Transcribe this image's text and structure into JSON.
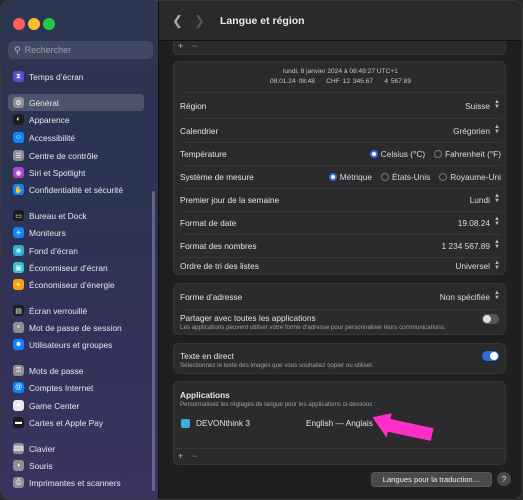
{
  "sidebar": {
    "search_placeholder": "Rechercher",
    "items": [
      {
        "label": "Temps d’écran",
        "icon": "hourglass-icon",
        "color": "#5a4fcf"
      },
      {
        "label": "Général",
        "icon": "gear-icon",
        "color": "#8e8e93"
      },
      {
        "label": "Apparence",
        "icon": "appearance-icon",
        "color": "#1c1c1e"
      },
      {
        "label": "Accessibilité",
        "icon": "accessibility-icon",
        "color": "#0a84ff"
      },
      {
        "label": "Centre de contrôle",
        "icon": "control-center-icon",
        "color": "#8e8e93"
      },
      {
        "label": "Siri et Spotlight",
        "icon": "siri-icon",
        "color": "#b040d0"
      },
      {
        "label": "Confidentialité et sécurité",
        "icon": "hand-icon",
        "color": "#0a84ff"
      },
      {
        "label": "Bureau et Dock",
        "icon": "dock-icon",
        "color": "#1c1c1e"
      },
      {
        "label": "Moniteurs",
        "icon": "display-icon",
        "color": "#0a84ff"
      },
      {
        "label": "Fond d’écran",
        "icon": "wallpaper-icon",
        "color": "#30b0d0"
      },
      {
        "label": "Économiseur d’écran",
        "icon": "screensaver-icon",
        "color": "#30c0d0"
      },
      {
        "label": "Économiseur d’énergie",
        "icon": "energy-icon",
        "color": "#ff9f0a"
      },
      {
        "label": "Écran verrouillé",
        "icon": "lock-screen-icon",
        "color": "#1c1c1e"
      },
      {
        "label": "Mot de passe de session",
        "icon": "password-icon",
        "color": "#8e8e93"
      },
      {
        "label": "Utilisateurs et groupes",
        "icon": "users-icon",
        "color": "#0a84ff"
      },
      {
        "label": "Mots de passe",
        "icon": "key-icon",
        "color": "#8e8e93"
      },
      {
        "label": "Comptes Internet",
        "icon": "at-icon",
        "color": "#0a84ff"
      },
      {
        "label": "Game Center",
        "icon": "game-center-icon",
        "color": "#e8e8e8"
      },
      {
        "label": "Cartes et Apple Pay",
        "icon": "wallet-icon",
        "color": "#1c1c1e"
      },
      {
        "label": "Clavier",
        "icon": "keyboard-icon",
        "color": "#8e8e93"
      },
      {
        "label": "Souris",
        "icon": "mouse-icon",
        "color": "#8e8e93"
      },
      {
        "label": "Imprimantes et scanners",
        "icon": "printer-icon",
        "color": "#8e8e93"
      }
    ],
    "selected": "Général"
  },
  "title": "Langue et région",
  "preview": {
    "line1": "lundi, 8 janvier 2024 à 08:48:27 UTC+1",
    "line2a": "08.01.24 08:48",
    "line2b": "CHF 12 345.67",
    "line2c": "4 567.89"
  },
  "settings": {
    "region": {
      "label": "Région",
      "value": "Suisse"
    },
    "calendar": {
      "label": "Calendrier",
      "value": "Grégorien"
    },
    "temperature": {
      "label": "Température",
      "opt1": "Celsius (°C)",
      "opt2": "Fahrenheit (°F)",
      "selected": "Celsius (°C)"
    },
    "measure": {
      "label": "Système de mesure",
      "opt1": "Métrique",
      "opt2": "États-Unis",
      "opt3": "Royaume-Uni",
      "selected": "Métrique"
    },
    "first_day": {
      "label": "Premier jour de la semaine",
      "value": "Lundi"
    },
    "date_format": {
      "label": "Format de date",
      "value": "19.08.24"
    },
    "number_format": {
      "label": "Format des nombres",
      "value": "1 234 567.89"
    },
    "sort_order": {
      "label": "Ordre de tri des listes",
      "value": "Universel"
    }
  },
  "address": {
    "label": "Forme d’adresse",
    "value": "Non spécifiée",
    "share_label": "Partager avec toutes les applications",
    "share_desc": "Les applications peuvent utiliser votre forme d’adresse pour personnaliser leurs communications.",
    "share_on": false
  },
  "live_text": {
    "label": "Texte en direct",
    "desc": "Sélectionnez le texte des images que vous souhaitez copier ou utiliser.",
    "on": true
  },
  "applications": {
    "title": "Applications",
    "desc": "Personnalisez les réglages de langue pour les applications ci-dessous :",
    "items": [
      {
        "name": "DEVONthink 3",
        "language": "English — Anglais"
      }
    ]
  },
  "translation_button": "Langues pour la traduction…",
  "colors": {
    "accent": "#2a6ed8",
    "annotation_arrow": "#ff2ec8"
  }
}
